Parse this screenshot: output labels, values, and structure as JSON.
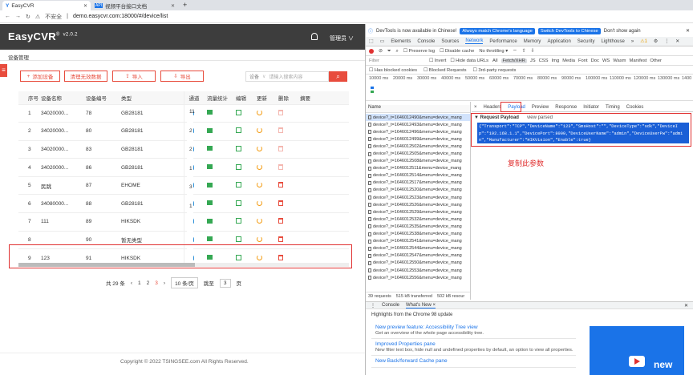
{
  "browser": {
    "tabs": [
      {
        "title": "EasyCVR",
        "active": true
      },
      {
        "title": "视频平台接口文档",
        "active": false
      }
    ],
    "new_tab": "+",
    "security": "不安全",
    "url": "demo.easycvr.com:18000/#/device/list"
  },
  "app": {
    "logo": "EasyCVR",
    "logo_mark": "®",
    "version": "v2.0.2",
    "user": "管理员 ∨",
    "breadcrumb": "设备管理",
    "toolbar": {
      "add": "添加设备",
      "clear": "清理无效数据",
      "import": "导入",
      "export": "导出",
      "search_type": "设备",
      "search_placeholder": "请输入搜索内容"
    },
    "table": {
      "headers": [
        "序号",
        "设备名称",
        "设备编号",
        "类型",
        "通道",
        "流量统计",
        "编辑",
        "更新",
        "删除",
        "摘要"
      ],
      "rows": [
        {
          "seq": "1",
          "name": "34020000...",
          "num": "78",
          "type": "GB28181",
          "extra": "11"
        },
        {
          "seq": "2",
          "name": "34020000...",
          "num": "80",
          "type": "GB28181",
          "extra": "2"
        },
        {
          "seq": "3",
          "name": "34020000...",
          "num": "83",
          "type": "GB28181",
          "extra": "2"
        },
        {
          "seq": "4",
          "name": "34020000...",
          "num": "86",
          "type": "GB28181",
          "extra": "1"
        },
        {
          "seq": "5",
          "name": "民跳",
          "num": "87",
          "type": "EHOME",
          "extra": "3"
        },
        {
          "seq": "6",
          "name": "34080000...",
          "num": "88",
          "type": "GB28181",
          "extra": "1"
        },
        {
          "seq": "7",
          "name": "111",
          "num": "89",
          "type": "HIKSDK",
          "extra": ""
        },
        {
          "seq": "8",
          "name": "",
          "num": "90",
          "type": "暂无类型",
          "extra": ""
        },
        {
          "seq": "9",
          "name": "123",
          "num": "91",
          "type": "HIKSDK",
          "extra": ""
        }
      ]
    },
    "pager": {
      "total": "共 29 条",
      "prev": "‹",
      "pages": [
        "1",
        "2",
        "3"
      ],
      "current": "3",
      "next": "›",
      "size": "10 条/页",
      "goto": "跳至",
      "goto_value": "3",
      "page_unit": "页"
    },
    "footer": "Copyright © 2022 TSINGSEE.com All Rights Reserved."
  },
  "devtools": {
    "info": "DevTools is now available in Chinese!",
    "info_btn1": "Always match Chrome's language",
    "info_btn2": "Switch DevTools to Chinese",
    "info_btn3": "Don't show again",
    "tabs": [
      "Elements",
      "Console",
      "Sources",
      "Network",
      "Performance",
      "Memory",
      "Application",
      "Security",
      "Lighthouse",
      "»"
    ],
    "active_tab": "Network",
    "badge": "⚠1",
    "toolbar": {
      "preserve": "Preserve log",
      "disable_cache": "Disable cache",
      "throttle": "No throttling"
    },
    "filter": {
      "label": "Filter",
      "invert": "Invert",
      "hide_data": "Hide data URLs",
      "types": [
        "All",
        "Fetch/XHR",
        "JS",
        "CSS",
        "Img",
        "Media",
        "Font",
        "Doc",
        "WS",
        "Wasm",
        "Manifest",
        "Other"
      ],
      "active_type": "Fetch/XHR"
    },
    "blocked": [
      "Has blocked cookies",
      "Blocked Requests",
      "3rd-party requests"
    ],
    "timeline": [
      "10000 ms",
      "20000 ms",
      "30000 ms",
      "40000 ms",
      "50000 ms",
      "60000 ms",
      "70000 ms",
      "80000 ms",
      "90000 ms",
      "100000 ms",
      "110000 ms",
      "120000 ms",
      "130000 ms",
      "1400"
    ],
    "requests": {
      "header": "Name",
      "items": [
        "device?_t=1646012490&menu=device_mang",
        "device?_t=1646012493&menu=device_mang",
        "device?_t=1646012496&menu=device_mang",
        "device?_t=1646012499&menu=device_mang",
        "device?_t=1646012502&menu=device_mang",
        "device?_t=1646012505&menu=device_mang",
        "device?_t=1646012508&menu=device_mang",
        "device?_t=1646012511&menu=device_mang",
        "device?_t=1646012514&menu=device_mang",
        "device?_t=1646012517&menu=device_mang",
        "device?_t=1646012520&menu=device_mang",
        "device?_t=1646012523&menu=device_mang",
        "device?_t=1646012526&menu=device_mang",
        "device?_t=1646012529&menu=device_mang",
        "device?_t=1646012532&menu=device_mang",
        "device?_t=1646012535&menu=device_mang",
        "device?_t=1646012538&menu=device_mang",
        "device?_t=1646012541&menu=device_mang",
        "device?_t=1646012544&menu=device_mang",
        "device?_t=1646012547&menu=device_mang",
        "device?_t=1646012550&menu=device_mang",
        "device?_t=1646012553&menu=device_mang",
        "device?_t=1646012556&menu=device_mang"
      ],
      "selected_index": 0,
      "status": [
        "39 requests",
        "515 kB transferred",
        "502 kB resour"
      ]
    },
    "detail_tabs": [
      "×",
      "Headers",
      "Payload",
      "Preview",
      "Response",
      "Initiator",
      "Timing",
      "Cookies"
    ],
    "active_detail_tab": "Payload",
    "request_payload_title": "▼ Request Payload",
    "view_parsed": "view parsed",
    "payload": "{\"Transport\":\"TCP\",\"DeviceName\":\"123\",\"SmsHost\":\"\",\"DeviceType\":\"sdk\",\"DeviceIp\":\"192.168.1.1\",\"DevicePort\":8000,\"DeviceUserName\":\"admin\",\"DeviceUserPw\":\"admin\",\"Manufacturer\":\"HIKVision\",\"Enable\":true}",
    "annotation": "复制此参数",
    "drawer_tabs": [
      "Console",
      "What's New ×"
    ],
    "highlights": "Highlights from the Chrome 98 update",
    "whats_new": [
      {
        "title": "New preview feature: Accessibility Tree view",
        "desc": "Get an overview of the whole page accessibility tree."
      },
      {
        "title": "Improved Properties pane",
        "desc": "New filter text box, hide null and undefined properties by default, an option to view all properties."
      },
      {
        "title": "New Back/forward Cache pane",
        "desc": ""
      }
    ],
    "promo_text": "new"
  },
  "colors": {
    "accent": "#e84c3d",
    "header": "#3d3d3d",
    "devtools_blue": "#1a73e8",
    "highlight": "#e03131"
  }
}
